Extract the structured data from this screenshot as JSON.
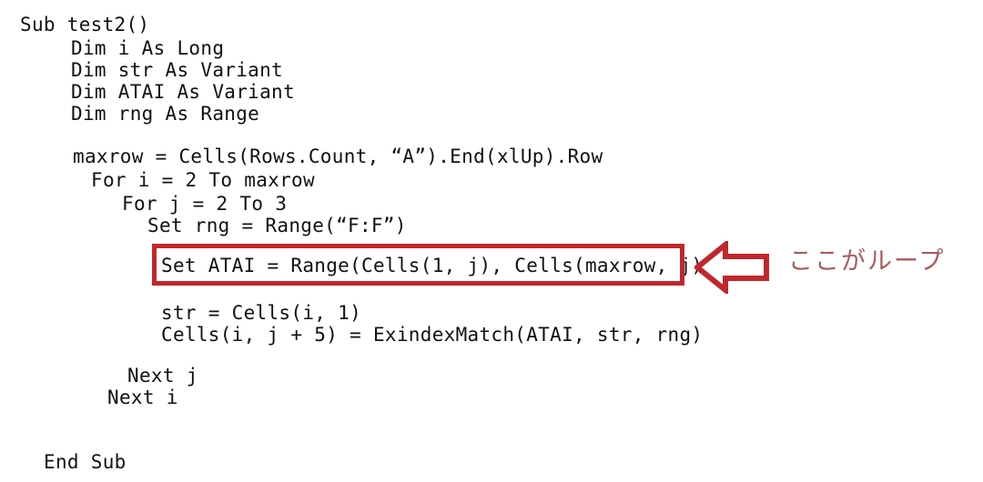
{
  "document": {
    "kind": "vba-code-screenshot",
    "background_color": "#FFFFFF",
    "code_color": "#111111"
  },
  "code": {
    "lines": [
      "Sub test2()",
      "Dim i As Long",
      "Dim str As Variant",
      "Dim ATAI As Variant",
      "Dim rng As Range",
      "maxrow = Cells(Rows.Count, “A”).End(xlUp).Row",
      "For i = 2 To maxrow",
      "For j = 2 To 3",
      "Set rng = Range(“F:F”)",
      "Set ATAI = Range(Cells(1, j), Cells(maxrow, j))",
      "str = Cells(i, 1)",
      "Cells(i, j + 5) = ExindexMatch(ATAI, str, rng)",
      "Next j",
      "Next i",
      "End Sub"
    ]
  },
  "annotation": {
    "highlight": {
      "target_line_index": 9,
      "border_color": "#C0272D",
      "border_width_px": 5
    },
    "arrow": {
      "direction": "left",
      "style": "hollow-block-arrow",
      "stroke_color": "#C0272D",
      "fill_color": "#FFFFFF"
    },
    "label": {
      "text": "ここがループ",
      "color": "#A85B5B"
    }
  }
}
